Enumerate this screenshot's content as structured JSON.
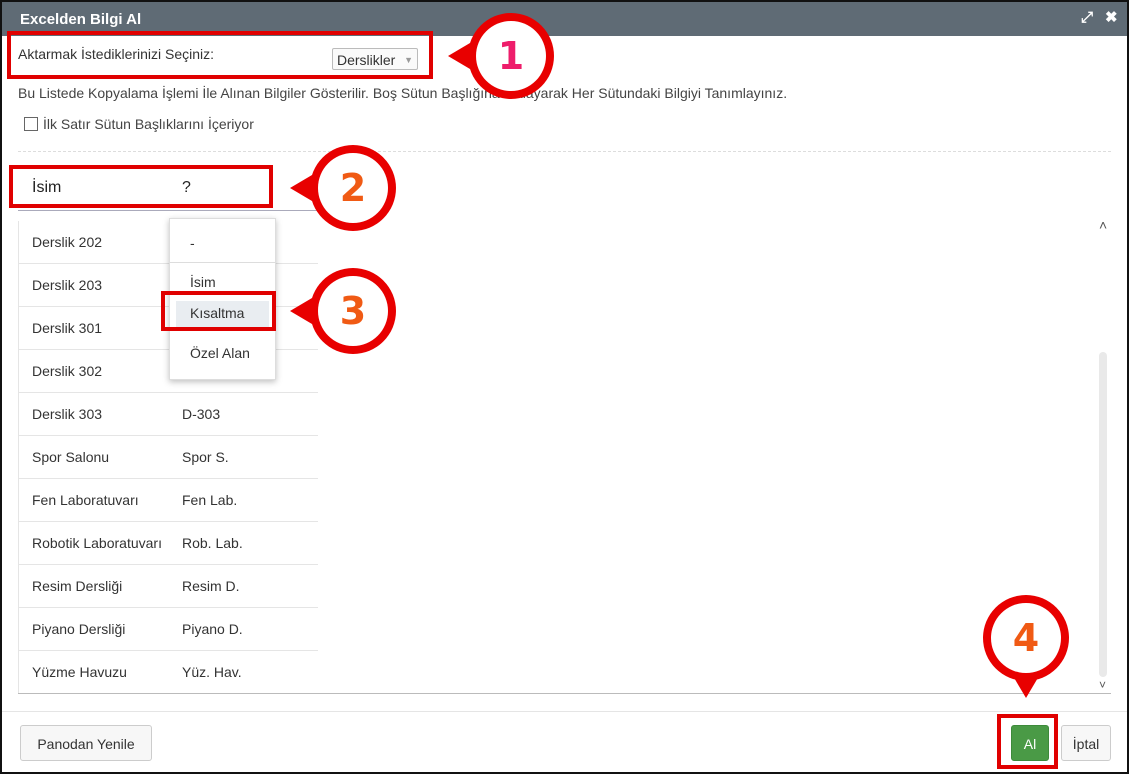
{
  "dialog": {
    "title": "Excelden Bilgi Al",
    "expand_icon": "⤢",
    "close_icon": "✖"
  },
  "selector": {
    "label": "Aktarmak İstediklerinizi Seçiniz:",
    "value": "Derslikler"
  },
  "info_text": "Bu Listede Kopyalama İşlemi İle Alınan Bilgiler Gösterilir. Boş Sütun Başlığına Tıklayarak Her Sütundaki Bilgiyi Tanımlayınız.",
  "header_checkbox_label": "İlk Satır Sütun Başlıklarını İçeriyor",
  "columns": [
    "İsim",
    "?"
  ],
  "rows": [
    [
      "Derslik 202",
      ""
    ],
    [
      "Derslik 203",
      ""
    ],
    [
      "Derslik 301",
      ""
    ],
    [
      "Derslik 302",
      ""
    ],
    [
      "Derslik 303",
      "D-303"
    ],
    [
      "Spor Salonu",
      "Spor S."
    ],
    [
      "Fen Laboratuvarı",
      "Fen Lab."
    ],
    [
      "Robotik Laboratuvarı",
      "Rob. Lab."
    ],
    [
      "Resim Dersliği",
      "Resim D."
    ],
    [
      "Piyano Dersliği",
      "Piyano D."
    ],
    [
      "Yüzme Havuzu",
      "Yüz. Hav."
    ]
  ],
  "dropdown_options": [
    "-",
    "İsim",
    "Kısaltma",
    "Özel Alan"
  ],
  "dropdown_highlighted": "Kısaltma",
  "buttons": {
    "refresh": "Panodan Yenile",
    "ok": "Al",
    "cancel": "İptal"
  },
  "markers": [
    "1",
    "2",
    "3",
    "4"
  ],
  "colors": {
    "titlebar": "#5f6b75",
    "annotation_red": "#e00000",
    "ok_button": "#4a9a46",
    "marker1_text": "#ee1d6b",
    "marker_text": "#f05a14"
  }
}
